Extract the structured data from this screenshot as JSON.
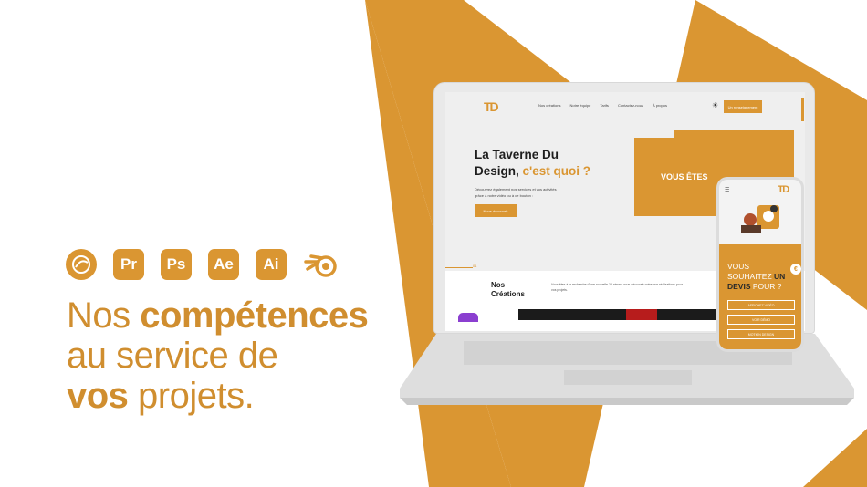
{
  "colors": {
    "accent": "#DA9632",
    "background": "#FFFFFF"
  },
  "tools": [
    {
      "name": "cinema4d-icon",
      "label": ""
    },
    {
      "name": "premiere-icon",
      "label": "Pr"
    },
    {
      "name": "photoshop-icon",
      "label": "Ps"
    },
    {
      "name": "after-effects-icon",
      "label": "Ae"
    },
    {
      "name": "illustrator-icon",
      "label": "Ai"
    },
    {
      "name": "blender-icon",
      "label": ""
    }
  ],
  "headline": {
    "l1a": "Nos ",
    "l1b": "compétences",
    "l2": "au service de",
    "l3a": "vos",
    "l3b": " projets."
  },
  "site": {
    "logo": "TD",
    "nav": [
      "Nos créations",
      "Notre équipe",
      "Tarifs",
      "Contactez-nous",
      "À propos"
    ],
    "cta": "Un renseignement",
    "hero_title_1": "La Taverne Du",
    "hero_title_2": "Design, ",
    "hero_title_accent": "c'est quoi ?",
    "hero_desc": "Découvrez également nos services et vos activités grâce à notre vidéo ou à ce bouton :",
    "hero_button": "Nous découvrir",
    "folder_text": "VOUS ÊTES",
    "section_number": "01",
    "section_title_1": "Nos",
    "section_title_2": "Créations",
    "section_desc": "Vous êtes à la recherche d'une nouvelle ? Laissez-vous découvrir notre nos réalisations pour vos projets."
  },
  "phone": {
    "logo": "TD",
    "menu": "☰",
    "title_1": "VOUS",
    "title_2": "SOUHAITEZ ",
    "title_accent": "UN",
    "title_3": "DEVIS",
    "title_4": " POUR ?",
    "euro": "€",
    "buttons": [
      "AFFICHEZ VIDÉO",
      "VOIR DÉMO",
      "MOTION DESIGN"
    ]
  }
}
